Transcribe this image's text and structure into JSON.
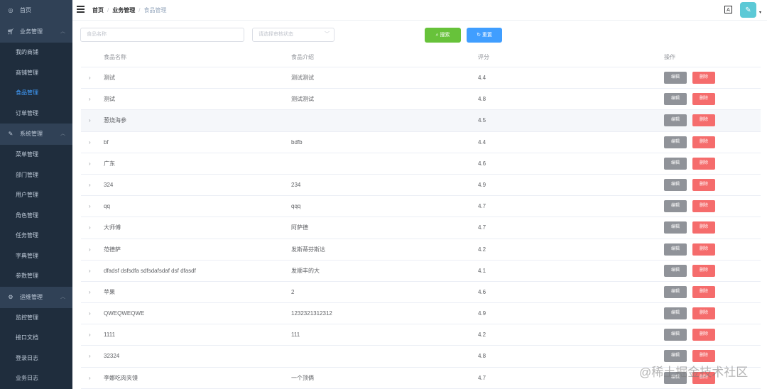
{
  "sidebar": {
    "home": "首页",
    "groups": [
      {
        "label": "业务管理",
        "icon": "cart-icon",
        "items": [
          "我的商铺",
          "商铺管理",
          "食品管理",
          "订单管理"
        ]
      },
      {
        "label": "系统管理",
        "icon": "edit-icon",
        "items": [
          "菜单管理",
          "部门管理",
          "用户管理",
          "角色管理",
          "任务管理",
          "字典管理",
          "参数管理"
        ]
      },
      {
        "label": "运维管理",
        "icon": "gear-icon",
        "items": [
          "监控管理",
          "接口文档",
          "登录日志",
          "业务日志"
        ]
      }
    ],
    "active_item": "食品管理"
  },
  "breadcrumb": [
    "首页",
    "业务管理",
    "食品管理"
  ],
  "search": {
    "name_placeholder": "食品名称",
    "status_placeholder": "请选择审核状态",
    "search_label": "搜索",
    "reset_label": "重置"
  },
  "table": {
    "headers": [
      "食品名称",
      "食品介绍",
      "评分",
      "操作"
    ],
    "edit_label": "编辑",
    "delete_label": "删除",
    "rows": [
      {
        "name": "测试",
        "intro": "测试测试",
        "score": "4.4"
      },
      {
        "name": "测试",
        "intro": "测试测试",
        "score": "4.8"
      },
      {
        "name": "葱烧海参",
        "intro": "",
        "score": "4.5"
      },
      {
        "name": "bf",
        "intro": "bdfb",
        "score": "4.4"
      },
      {
        "name": "广东",
        "intro": "",
        "score": "4.6"
      },
      {
        "name": "324",
        "intro": "234",
        "score": "4.9"
      },
      {
        "name": "qq",
        "intro": "qqq",
        "score": "4.7"
      },
      {
        "name": "大师傅",
        "intro": "阿萨德",
        "score": "4.7"
      },
      {
        "name": "范德萨",
        "intro": "发斯蒂芬斯达",
        "score": "4.2"
      },
      {
        "name": "dfadsf dsfsdfa sdfsdafsdaf dsf dfasdf",
        "intro": "发顺丰的大",
        "score": "4.1"
      },
      {
        "name": "苹果",
        "intro": "2",
        "score": "4.6"
      },
      {
        "name": "QWEQWEQWE",
        "intro": "1232321312312",
        "score": "4.9"
      },
      {
        "name": "1111",
        "intro": "111",
        "score": "4.2"
      },
      {
        "name": "32324",
        "intro": "",
        "score": "4.8"
      },
      {
        "name": "李娜吃肉夹馍",
        "intro": "一个顶俩",
        "score": "4.7"
      }
    ]
  },
  "watermark": "@稀土掘金技术社区"
}
